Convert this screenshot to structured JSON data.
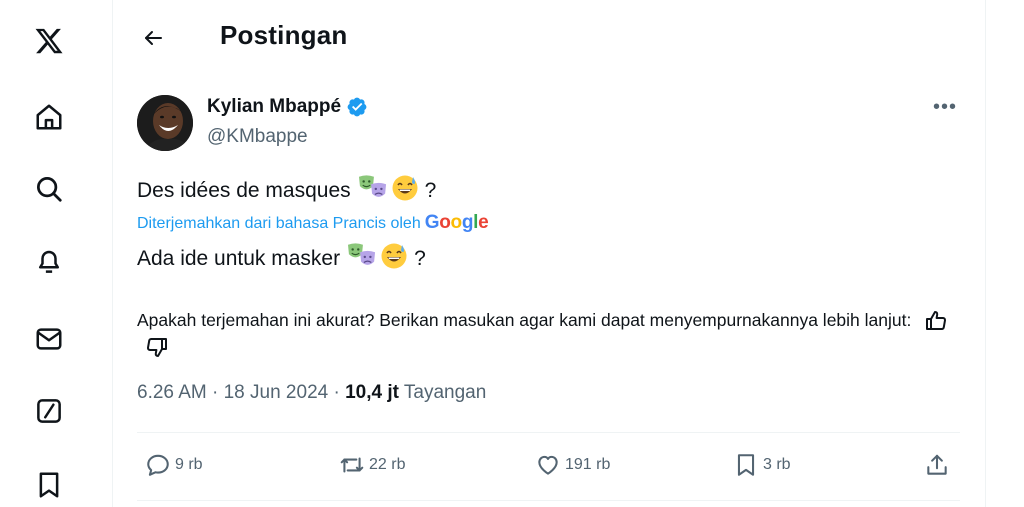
{
  "nav": {
    "items": [
      {
        "name": "x-logo-icon"
      },
      {
        "name": "home-icon"
      },
      {
        "name": "search-icon"
      },
      {
        "name": "notifications-bell-icon"
      },
      {
        "name": "messages-mail-icon"
      },
      {
        "name": "grok-slash-icon"
      },
      {
        "name": "bookmark-icon"
      }
    ]
  },
  "header": {
    "title": "Postingan",
    "back_icon": "arrow-left-icon"
  },
  "post": {
    "author_name": "Kylian Mbappé",
    "author_handle": "@KMbappe",
    "verified_color": "#1d9bf0",
    "original_text": "Des idées de masques",
    "original_suffix": "?",
    "translated_label": "Diterjemahkan dari bahasa Prancis oleh",
    "translator_logo": "Google",
    "translated_text": "Ada ide untuk masker",
    "translated_suffix": "?",
    "emojis": [
      "performing-arts-masks",
      "grinning-sweat"
    ],
    "feedback_text": "Apakah terjemahan ini akurat? Berikan masukan agar kami dapat menyempurnakannya lebih lanjut:",
    "time": "6.26 AM",
    "date": "18 Jun 2024",
    "separator": "·",
    "views_count": "10,4 jt",
    "views_label": "Tayangan"
  },
  "actions": {
    "replies": "9 rb",
    "reposts": "22 rb",
    "likes": "191 rb",
    "bookmarks": "3 rb"
  },
  "colors": {
    "accent": "#1d9bf0",
    "text": "#0f1419",
    "muted": "#536471",
    "border": "#eff3f4"
  }
}
